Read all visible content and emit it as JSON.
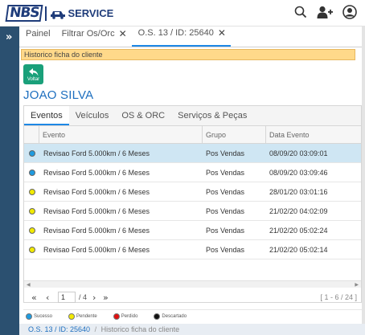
{
  "app": {
    "logo_text": "NBS",
    "brand_text": "SERVICE"
  },
  "header_icons": [
    "search-icon",
    "add-user-icon",
    "user-avatar-icon"
  ],
  "tabs": [
    {
      "label": "Painel",
      "closable": false
    },
    {
      "label": "Filtrar Os/Orc",
      "closable": true
    },
    {
      "label": "O.S. 13 / ID: 25640",
      "closable": true,
      "active": true
    }
  ],
  "banner": "Historico ficha do cliente",
  "back_button": {
    "label": "Voltar",
    "color": "#1aa07a"
  },
  "client_name": "JOAO SILVA",
  "subtabs": [
    "Eventos",
    "Veículos",
    "OS & ORC",
    "Serviços & Peças"
  ],
  "grid": {
    "columns": [
      "Evento",
      "Grupo",
      "Data Evento"
    ],
    "rows": [
      {
        "status": "sucesso",
        "evento": "Revisao Ford 5.000km / 6 Meses",
        "grupo": "Pos Vendas",
        "data": "08/09/20 03:09:01",
        "selected": true
      },
      {
        "status": "sucesso",
        "evento": "Revisao Ford 5.000km / 6 Meses",
        "grupo": "Pos Vendas",
        "data": "08/09/20 03:09:46",
        "selected": false
      },
      {
        "status": "pendente",
        "evento": "Revisao Ford 5.000km / 6 Meses",
        "grupo": "Pos Vendas",
        "data": "28/01/20 03:01:16",
        "selected": false
      },
      {
        "status": "pendente",
        "evento": "Revisao Ford 5.000km / 6 Meses",
        "grupo": "Pos Vendas",
        "data": "21/02/20 04:02:09",
        "selected": false
      },
      {
        "status": "pendente",
        "evento": "Revisao Ford 5.000km / 6 Meses",
        "grupo": "Pos Vendas",
        "data": "21/02/20 05:02:24",
        "selected": false
      },
      {
        "status": "pendente",
        "evento": "Revisao Ford 5.000km / 6 Meses",
        "grupo": "Pos Vendas",
        "data": "21/02/20 05:02:14",
        "selected": false
      }
    ]
  },
  "pager": {
    "page": "1",
    "of": "/ 4",
    "range": "[ 1 - 6 / 24 ]"
  },
  "legend": [
    {
      "key": "sucesso",
      "label": "Sucesso",
      "color": "#1e9be0"
    },
    {
      "key": "pendente",
      "label": "Pendente",
      "color": "#f2ea00"
    },
    {
      "key": "perdido",
      "label": "Perdido",
      "color": "#e01010"
    },
    {
      "key": "descartado",
      "label": "Descartado",
      "color": "#111111"
    }
  ],
  "breadcrumb": {
    "link": "O.S. 13 / ID: 25640",
    "separator": "/",
    "current": "Historico ficha do cliente"
  }
}
